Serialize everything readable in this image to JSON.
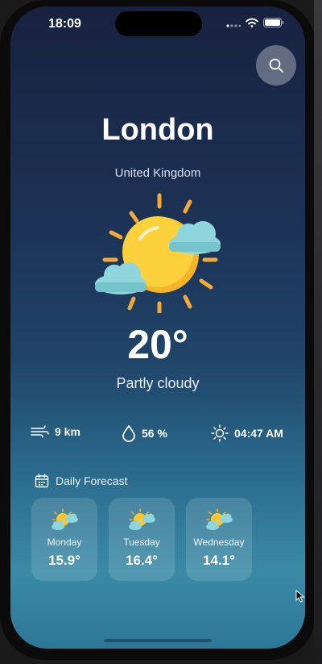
{
  "status_bar": {
    "time": "18:09"
  },
  "location": {
    "city": "London",
    "country": "United Kingdom"
  },
  "current": {
    "temperature": "20°",
    "condition": "Partly cloudy",
    "icon": "sun-with-clouds-icon"
  },
  "stats": {
    "wind": "9 km",
    "humidity": "56 %",
    "sunrise": "04:47 AM"
  },
  "forecast": {
    "header": "Daily Forecast",
    "days": [
      {
        "day": "Monday",
        "temp": "15.9°",
        "icon": "partly-cloudy-icon"
      },
      {
        "day": "Tuesday",
        "temp": "16.4°",
        "icon": "partly-cloudy-icon"
      },
      {
        "day": "Wednesday",
        "temp": "14.1°",
        "icon": "partly-cloudy-icon"
      }
    ]
  },
  "colors": {
    "sun": "#fdc830",
    "cloud": "#8fd6dc",
    "background_top": "#17223f",
    "background_bottom": "#3a8aa6"
  }
}
